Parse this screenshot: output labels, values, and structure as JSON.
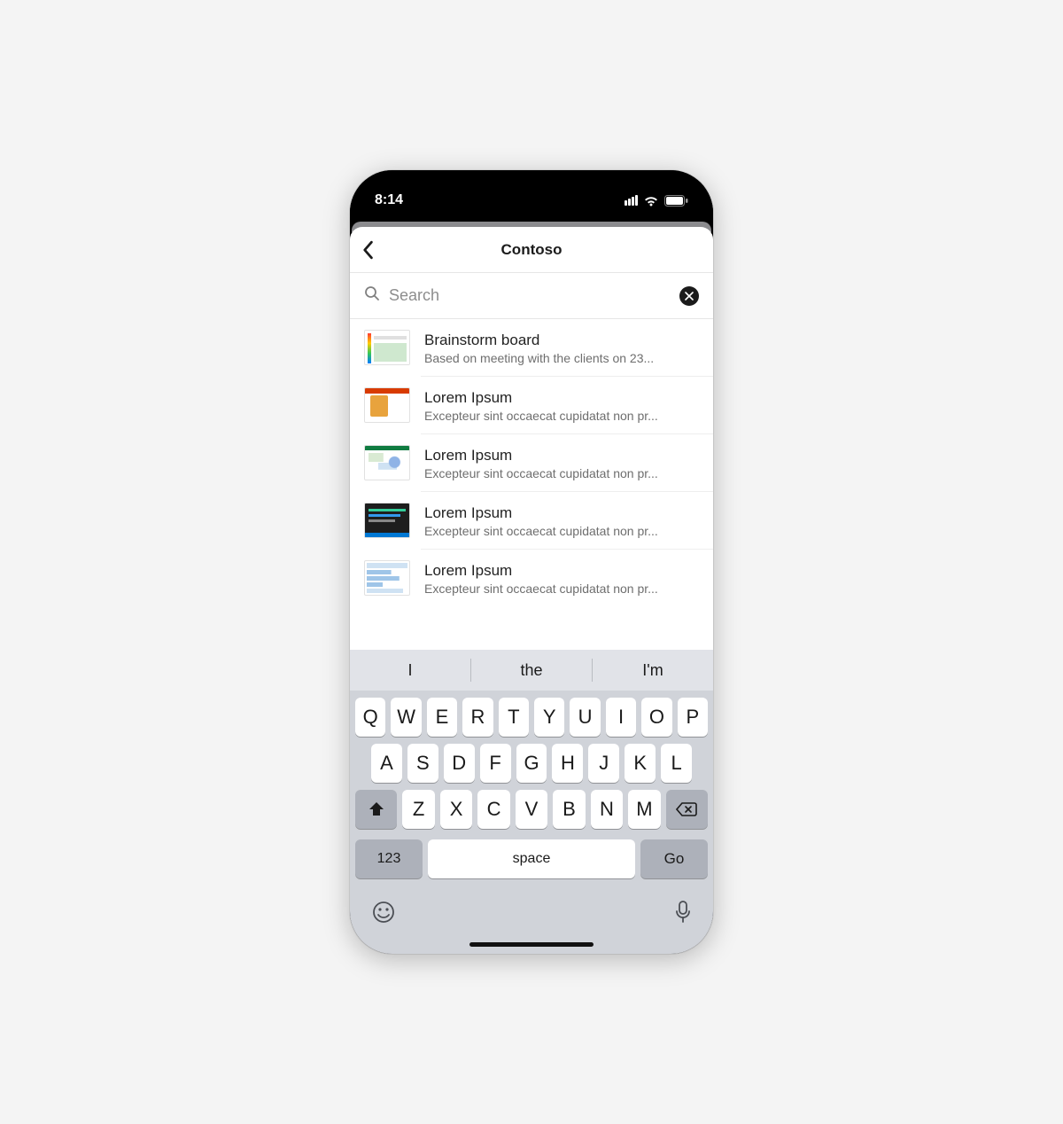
{
  "status": {
    "time": "8:14"
  },
  "header": {
    "title": "Contoso"
  },
  "search": {
    "placeholder": "Search",
    "value": ""
  },
  "results": [
    {
      "title": "Brainstorm board",
      "subtitle": "Based on meeting with the clients on 23..."
    },
    {
      "title": "Lorem Ipsum",
      "subtitle": "Excepteur sint occaecat cupidatat non pr..."
    },
    {
      "title": "Lorem Ipsum",
      "subtitle": "Excepteur sint occaecat cupidatat non pr..."
    },
    {
      "title": "Lorem Ipsum",
      "subtitle": "Excepteur sint occaecat cupidatat non pr..."
    },
    {
      "title": "Lorem Ipsum",
      "subtitle": "Excepteur sint occaecat cupidatat non pr..."
    }
  ],
  "keyboard": {
    "suggestions": [
      "I",
      "the",
      "I'm"
    ],
    "row1": [
      "Q",
      "W",
      "E",
      "R",
      "T",
      "Y",
      "U",
      "I",
      "O",
      "P"
    ],
    "row2": [
      "A",
      "S",
      "D",
      "F",
      "G",
      "H",
      "J",
      "K",
      "L"
    ],
    "row3": [
      "Z",
      "X",
      "C",
      "V",
      "B",
      "N",
      "M"
    ],
    "numKey": "123",
    "space": "space",
    "go": "Go"
  }
}
